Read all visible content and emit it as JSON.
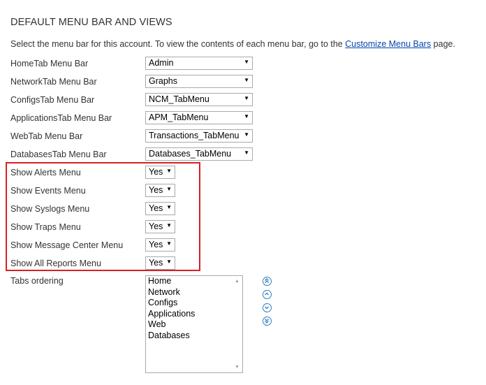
{
  "title": "DEFAULT MENU BAR AND VIEWS",
  "intro": {
    "text_before": "Select the menu bar for this account. To view the contents of each menu bar, go to the ",
    "link": "Customize Menu Bars",
    "text_after": " page."
  },
  "menu_bars": [
    {
      "label": "HomeTab Menu Bar",
      "value": "Admin"
    },
    {
      "label": "NetworkTab Menu Bar",
      "value": "Graphs"
    },
    {
      "label": "ConfigsTab Menu Bar",
      "value": "NCM_TabMenu"
    },
    {
      "label": "ApplicationsTab Menu Bar",
      "value": "APM_TabMenu"
    },
    {
      "label": "WebTab Menu Bar",
      "value": "Transactions_TabMenu"
    },
    {
      "label": "DatabasesTab Menu Bar",
      "value": "Databases_TabMenu"
    }
  ],
  "show_menus": [
    {
      "label": "Show Alerts Menu",
      "value": "Yes"
    },
    {
      "label": "Show Events Menu",
      "value": "Yes"
    },
    {
      "label": "Show Syslogs Menu",
      "value": "Yes"
    },
    {
      "label": "Show Traps Menu",
      "value": "Yes"
    },
    {
      "label": "Show Message Center Menu",
      "value": "Yes"
    },
    {
      "label": "Show All Reports Menu",
      "value": "Yes"
    }
  ],
  "tabs_ordering": {
    "label": "Tabs ordering",
    "items": [
      "Home",
      "Network",
      "Configs",
      "Applications",
      "Web",
      "Databases"
    ]
  },
  "ordering_buttons": [
    "move-to-top-icon",
    "move-up-icon",
    "move-down-icon",
    "move-to-bottom-icon"
  ],
  "colors": {
    "highlight": "#d81f26",
    "link": "#0645ad",
    "button": "#2f7ec0"
  }
}
